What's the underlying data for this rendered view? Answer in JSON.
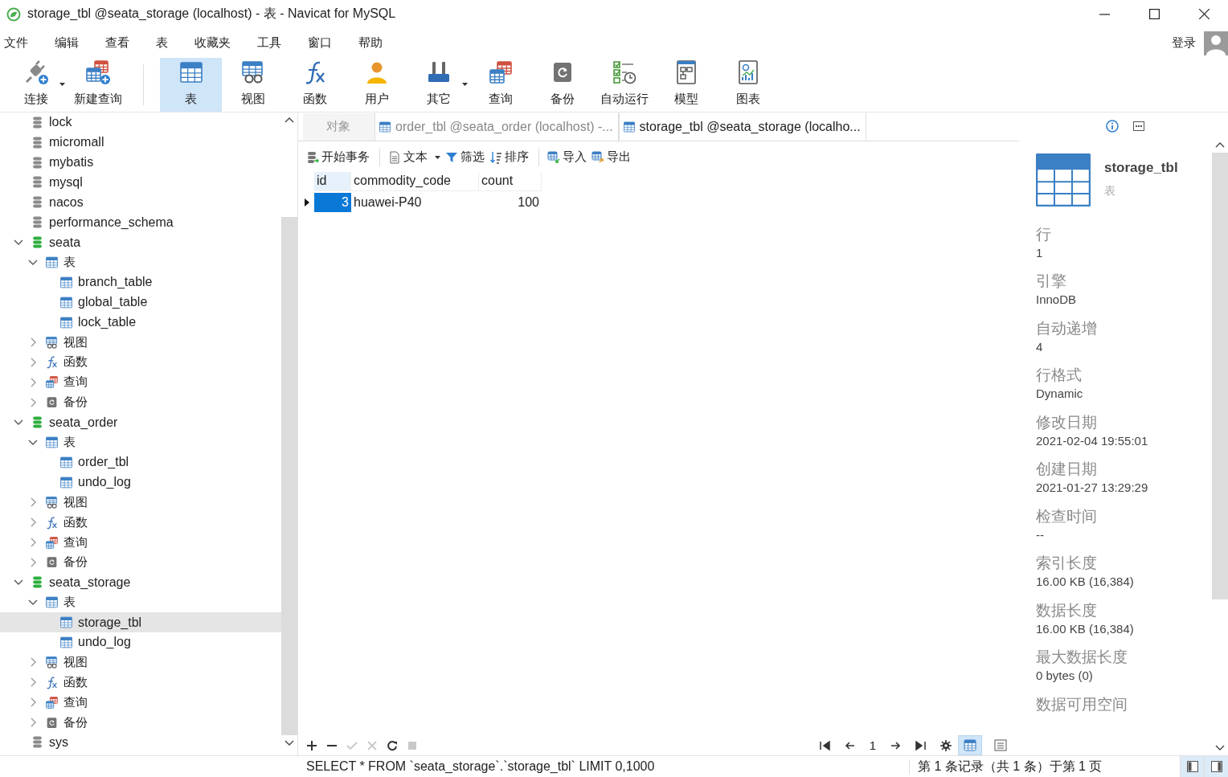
{
  "window": {
    "title": "storage_tbl @seata_storage (localhost) - 表 - Navicat for MySQL"
  },
  "menu": [
    "文件",
    "编辑",
    "查看",
    "表",
    "收藏夹",
    "工具",
    "窗口",
    "帮助"
  ],
  "account": {
    "label": "登录"
  },
  "toolbar": {
    "groups": [
      [
        {
          "label": "连接",
          "kind": "connect",
          "dropdown": true,
          "selected": false
        },
        {
          "label": "新建查询",
          "kind": "new-query",
          "dropdown": false,
          "selected": false
        }
      ],
      [
        {
          "label": "表",
          "kind": "table",
          "dropdown": false,
          "selected": true
        },
        {
          "label": "视图",
          "kind": "view",
          "dropdown": false,
          "selected": false
        },
        {
          "label": "函数",
          "kind": "function",
          "dropdown": false,
          "selected": false
        },
        {
          "label": "用户",
          "kind": "user",
          "dropdown": false,
          "selected": false
        },
        {
          "label": "其它",
          "kind": "other",
          "dropdown": true,
          "selected": false
        },
        {
          "label": "查询",
          "kind": "query",
          "dropdown": false,
          "selected": false
        },
        {
          "label": "备份",
          "kind": "backup",
          "dropdown": false,
          "selected": false
        },
        {
          "label": "自动运行",
          "kind": "automation",
          "dropdown": false,
          "selected": false
        },
        {
          "label": "模型",
          "kind": "model",
          "dropdown": false,
          "selected": false
        },
        {
          "label": "图表",
          "kind": "chart",
          "dropdown": false,
          "selected": false
        }
      ]
    ]
  },
  "sidebar": {
    "tree": [
      {
        "label": "lock",
        "kind": "database",
        "opened": false,
        "selected": false
      },
      {
        "label": "micromall",
        "kind": "database",
        "opened": false,
        "selected": false
      },
      {
        "label": "mybatis",
        "kind": "database",
        "opened": false,
        "selected": false
      },
      {
        "label": "mysql",
        "kind": "database",
        "opened": false,
        "selected": false
      },
      {
        "label": "nacos",
        "kind": "database",
        "opened": false,
        "selected": false
      },
      {
        "label": "performance_schema",
        "kind": "database",
        "opened": false,
        "selected": false
      },
      {
        "label": "seata",
        "kind": "database",
        "opened": true,
        "expanded": true,
        "selected": false,
        "children": [
          {
            "label": "表",
            "kind": "tables",
            "expanded": true,
            "selected": false,
            "children": [
              {
                "label": "branch_table",
                "kind": "table",
                "selected": false
              },
              {
                "label": "global_table",
                "kind": "table",
                "selected": false
              },
              {
                "label": "lock_table",
                "kind": "table",
                "selected": false
              }
            ]
          },
          {
            "label": "视图",
            "kind": "views",
            "expanded": false,
            "selected": false
          },
          {
            "label": "函数",
            "kind": "functions",
            "expanded": false,
            "selected": false
          },
          {
            "label": "查询",
            "kind": "queries",
            "expanded": false,
            "selected": false
          },
          {
            "label": "备份",
            "kind": "backups",
            "expanded": false,
            "selected": false
          }
        ]
      },
      {
        "label": "seata_order",
        "kind": "database",
        "opened": true,
        "expanded": true,
        "selected": false,
        "children": [
          {
            "label": "表",
            "kind": "tables",
            "expanded": true,
            "selected": false,
            "children": [
              {
                "label": "order_tbl",
                "kind": "table",
                "selected": false
              },
              {
                "label": "undo_log",
                "kind": "table",
                "selected": false
              }
            ]
          },
          {
            "label": "视图",
            "kind": "views",
            "expanded": false,
            "selected": false
          },
          {
            "label": "函数",
            "kind": "functions",
            "expanded": false,
            "selected": false
          },
          {
            "label": "查询",
            "kind": "queries",
            "expanded": false,
            "selected": false
          },
          {
            "label": "备份",
            "kind": "backups",
            "expanded": false,
            "selected": false
          }
        ]
      },
      {
        "label": "seata_storage",
        "kind": "database",
        "opened": true,
        "expanded": true,
        "selected": false,
        "children": [
          {
            "label": "表",
            "kind": "tables",
            "expanded": true,
            "selected": false,
            "children": [
              {
                "label": "storage_tbl",
                "kind": "table",
                "selected": true
              },
              {
                "label": "undo_log",
                "kind": "table",
                "selected": false
              }
            ]
          },
          {
            "label": "视图",
            "kind": "views",
            "expanded": false,
            "selected": false
          },
          {
            "label": "函数",
            "kind": "functions",
            "expanded": false,
            "selected": false
          },
          {
            "label": "查询",
            "kind": "queries",
            "expanded": false,
            "selected": false
          },
          {
            "label": "备份",
            "kind": "backups",
            "expanded": false,
            "selected": false
          }
        ]
      },
      {
        "label": "sys",
        "kind": "database",
        "opened": false,
        "selected": false
      }
    ]
  },
  "tabs": [
    {
      "label": "对象",
      "kind": "objects",
      "selected": false
    },
    {
      "label": "order_tbl @seata_order (localhost) -...",
      "kind": "table",
      "selected": false
    },
    {
      "label": "storage_tbl @seata_storage (localho...",
      "kind": "table",
      "selected": true
    }
  ],
  "data_toolbar": {
    "groups": [
      [
        {
          "label": "开始事务",
          "kind": "transaction",
          "dropdown": false
        }
      ],
      [
        {
          "label": "文本",
          "kind": "text",
          "dropdown": true
        },
        {
          "label": "筛选",
          "kind": "filter",
          "dropdown": false
        },
        {
          "label": "排序",
          "kind": "sort",
          "dropdown": false
        }
      ],
      [
        {
          "label": "导入",
          "kind": "import",
          "dropdown": false
        },
        {
          "label": "导出",
          "kind": "export",
          "dropdown": false
        }
      ]
    ]
  },
  "grid": {
    "columns": [
      {
        "label": "id",
        "numeric": true
      },
      {
        "label": "commodity_code",
        "numeric": false
      },
      {
        "label": "count",
        "numeric": true
      }
    ],
    "rows": [
      {
        "current": true,
        "cells": [
          {
            "text": "3",
            "selected": true
          },
          {
            "text": "huawei-P40",
            "selected": false
          },
          {
            "text": "100",
            "selected": false
          }
        ]
      }
    ]
  },
  "record_bar": {
    "actions": [
      {
        "kind": "add",
        "disabled": false
      },
      {
        "kind": "remove",
        "disabled": false
      },
      {
        "kind": "apply",
        "disabled": true
      },
      {
        "kind": "discard",
        "disabled": true
      },
      {
        "kind": "refresh",
        "disabled": false
      },
      {
        "kind": "stop",
        "disabled": true
      }
    ],
    "page": "1",
    "views": [
      {
        "kind": "grid",
        "selected": true
      },
      {
        "kind": "form",
        "selected": false
      }
    ]
  },
  "info": {
    "name": "storage_tbl",
    "type": "表",
    "properties": [
      {
        "label": "行",
        "value": "1"
      },
      {
        "label": "引擎",
        "value": "InnoDB"
      },
      {
        "label": "自动递增",
        "value": "4"
      },
      {
        "label": "行格式",
        "value": "Dynamic"
      },
      {
        "label": "修改日期",
        "value": "2021-02-04 19:55:01"
      },
      {
        "label": "创建日期",
        "value": "2021-01-27 13:29:29"
      },
      {
        "label": "检查时间",
        "value": "--"
      },
      {
        "label": "索引长度",
        "value": "16.00 KB (16,384)"
      },
      {
        "label": "数据长度",
        "value": "16.00 KB (16,384)"
      },
      {
        "label": "最大数据长度",
        "value": "0 bytes (0)"
      },
      {
        "label": "数据可用空间"
      }
    ]
  },
  "status_bar": {
    "sql": "SELECT * FROM `seata_storage`.`storage_tbl` LIMIT 0,1000",
    "record": "第 1 条记录（共 1 条）于第 1 页",
    "panes": [
      {
        "kind": "left",
        "selected": true
      },
      {
        "kind": "right",
        "selected": true
      }
    ]
  }
}
